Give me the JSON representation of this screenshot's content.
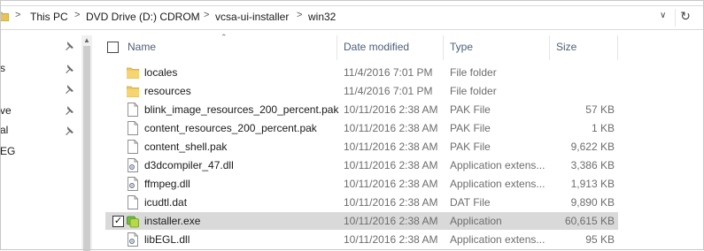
{
  "breadcrumb": {
    "items": [
      "This PC",
      "DVD Drive (D:) CDROM",
      "vcsa-ui-installer",
      "win32"
    ],
    "separator": ">"
  },
  "nav": {
    "items": [
      "s",
      "",
      "ve",
      "al",
      "EG"
    ]
  },
  "columns": {
    "name": "Name",
    "date": "Date modified",
    "type": "Type",
    "size": "Size"
  },
  "files": [
    {
      "name": "locales",
      "date": "11/4/2016 7:01 PM",
      "type": "File folder",
      "size": "",
      "icon": "folder-icon"
    },
    {
      "name": "resources",
      "date": "11/4/2016 7:01 PM",
      "type": "File folder",
      "size": "",
      "icon": "folder-icon"
    },
    {
      "name": "blink_image_resources_200_percent.pak",
      "date": "10/11/2016 2:38 AM",
      "type": "PAK File",
      "size": "57 KB",
      "icon": "file-icon"
    },
    {
      "name": "content_resources_200_percent.pak",
      "date": "10/11/2016 2:38 AM",
      "type": "PAK File",
      "size": "1 KB",
      "icon": "file-icon"
    },
    {
      "name": "content_shell.pak",
      "date": "10/11/2016 2:38 AM",
      "type": "PAK File",
      "size": "9,622 KB",
      "icon": "file-icon"
    },
    {
      "name": "d3dcompiler_47.dll",
      "date": "10/11/2016 2:38 AM",
      "type": "Application extens...",
      "size": "3,386 KB",
      "icon": "dll-icon"
    },
    {
      "name": "ffmpeg.dll",
      "date": "10/11/2016 2:38 AM",
      "type": "Application extens...",
      "size": "1,913 KB",
      "icon": "dll-icon"
    },
    {
      "name": "icudtl.dat",
      "date": "10/11/2016 2:38 AM",
      "type": "DAT File",
      "size": "9,890 KB",
      "icon": "file-icon"
    },
    {
      "name": "installer.exe",
      "date": "10/11/2016 2:38 AM",
      "type": "Application",
      "size": "60,615 KB",
      "icon": "exe-icon",
      "selected": true
    },
    {
      "name": "libEGL.dll",
      "date": "10/11/2016 2:38 AM",
      "type": "Application extens...",
      "size": "95 KB",
      "icon": "dll-icon"
    }
  ]
}
